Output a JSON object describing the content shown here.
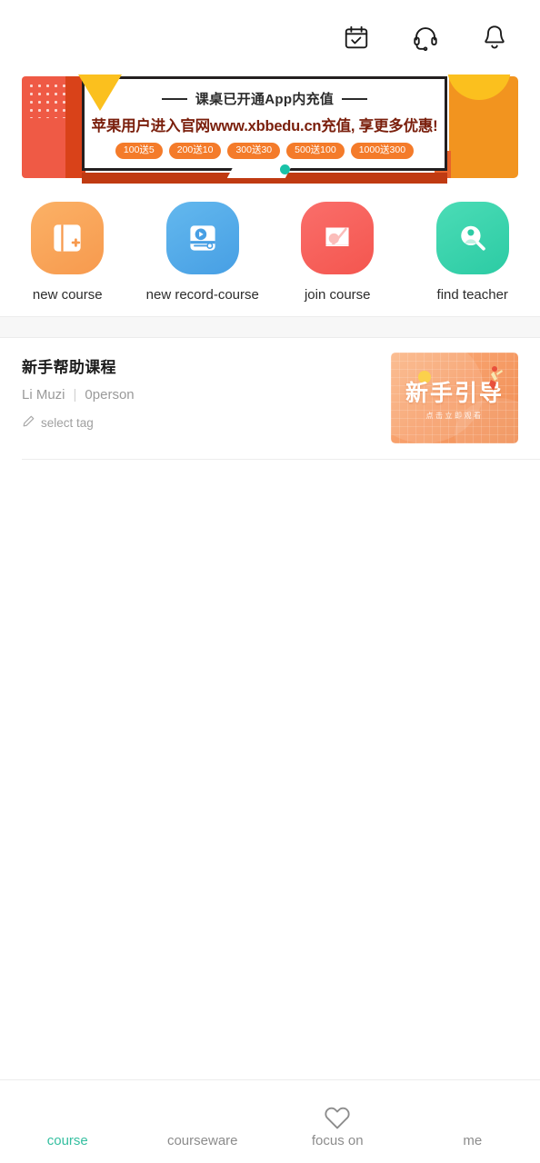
{
  "header": {
    "icons": [
      {
        "name": "calendar-check-icon",
        "label": "calendar"
      },
      {
        "name": "headset-icon",
        "label": "customer service"
      },
      {
        "name": "bell-icon",
        "label": "notifications"
      }
    ]
  },
  "banner": {
    "headline_top": "课桌已开通App内充值",
    "headline_main": "苹果用户进入官网www.xbbedu.cn充值, 享更多优惠!",
    "badges": [
      "100送5",
      "200送10",
      "300送30",
      "500送100",
      "1000送300"
    ],
    "colors": {
      "left_panel": "#ef5a45",
      "left_strip": "#d94219",
      "right_panel": "#f2941f",
      "arc": "#fbc01e",
      "triangle": "#fbc01e",
      "badge": "#f47b2a",
      "base": "#c03a12",
      "dot": "#19c2a8",
      "headline_main": "#7a1f0c"
    }
  },
  "actions": [
    {
      "label": "new course",
      "icon": "new-course-icon",
      "color": "#f79a4e"
    },
    {
      "label": "new record-course",
      "icon": "record-course-icon",
      "color": "#479fe4"
    },
    {
      "label": "join course",
      "icon": "join-course-icon",
      "color": "#f4564f"
    },
    {
      "label": "find teacher",
      "icon": "find-teacher-icon",
      "color": "#2ccba4"
    }
  ],
  "course": {
    "title": "新手帮助课程",
    "author": "Li Muzi",
    "separator": "|",
    "participants": "0person",
    "tag_label": "select tag",
    "tag_icon": "pencil-icon",
    "thumbnail": {
      "main_text": "新手引导",
      "sub_text": "点击立即观看"
    }
  },
  "tabbar": {
    "active_color": "#35bfa0",
    "tabs": [
      {
        "label": "course",
        "icon": "",
        "active": true
      },
      {
        "label": "courseware",
        "icon": "",
        "active": false
      },
      {
        "label": "focus on",
        "icon": "heart-icon",
        "active": false
      },
      {
        "label": "me",
        "icon": "",
        "active": false
      }
    ]
  }
}
